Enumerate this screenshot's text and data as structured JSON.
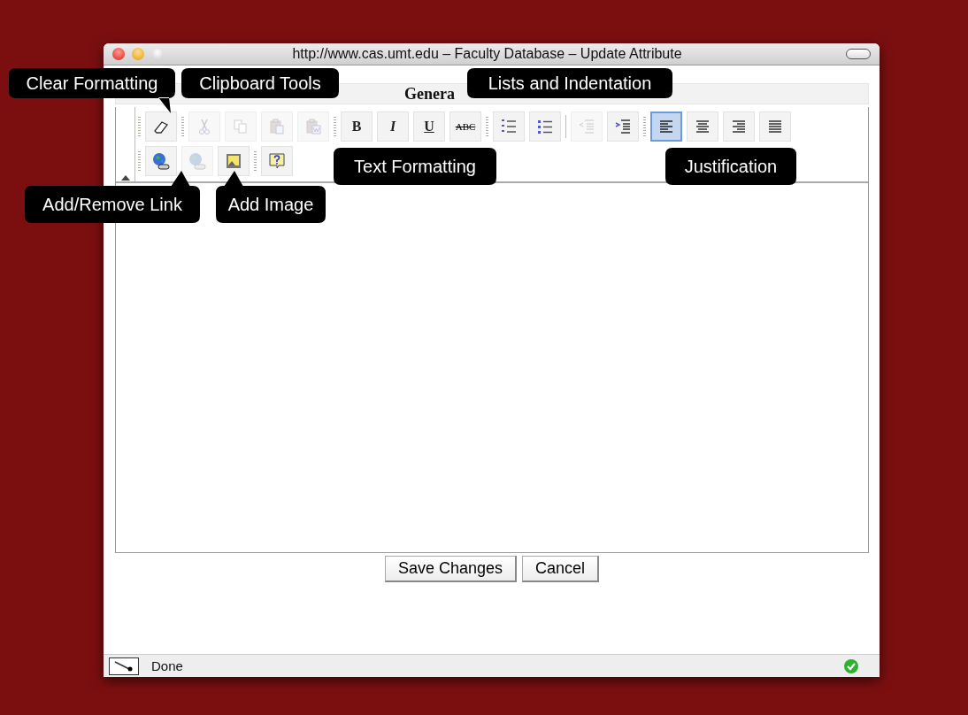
{
  "window": {
    "title": "http://www.cas.umt.edu – Faculty Database – Update Attribute"
  },
  "section_heading": "Genera",
  "toolbar_rows": [
    [
      {
        "kind": "grip"
      },
      {
        "kind": "button",
        "disabled": false,
        "selected": false
      },
      {
        "kind": "grip"
      },
      {
        "kind": "button",
        "disabled": true,
        "selected": false
      },
      {
        "kind": "button",
        "disabled": true,
        "selected": false
      },
      {
        "kind": "button",
        "disabled": true,
        "selected": false
      },
      {
        "kind": "button",
        "disabled": true,
        "selected": false
      },
      {
        "kind": "grip"
      },
      {
        "kind": "button",
        "label": "B",
        "disabled": false,
        "selected": false
      },
      {
        "kind": "button",
        "label": "I",
        "disabled": false,
        "selected": false
      },
      {
        "kind": "button",
        "label": "U",
        "disabled": false,
        "selected": false
      },
      {
        "kind": "button",
        "label": "ABC",
        "disabled": false,
        "selected": false
      },
      {
        "kind": "grip"
      },
      {
        "kind": "button",
        "disabled": false,
        "selected": false
      },
      {
        "kind": "button",
        "disabled": false,
        "selected": false
      },
      {
        "kind": "separator"
      },
      {
        "kind": "button",
        "disabled": true,
        "selected": false
      },
      {
        "kind": "button",
        "disabled": false,
        "selected": false
      },
      {
        "kind": "grip"
      },
      {
        "kind": "button",
        "disabled": false,
        "selected": true
      },
      {
        "kind": "button",
        "disabled": false,
        "selected": false
      },
      {
        "kind": "button",
        "disabled": false,
        "selected": false
      },
      {
        "kind": "button",
        "disabled": false,
        "selected": false
      }
    ],
    [
      {
        "kind": "grip"
      },
      {
        "kind": "button",
        "disabled": false,
        "selected": false
      },
      {
        "kind": "button",
        "disabled": true,
        "selected": false
      },
      {
        "kind": "button",
        "disabled": false,
        "selected": false
      },
      {
        "kind": "grip"
      },
      {
        "kind": "button",
        "disabled": false,
        "selected": false
      }
    ]
  ],
  "buttons": [
    "Save Changes",
    "Cancel"
  ],
  "status_bar": {
    "text": "Done"
  },
  "callouts": [
    {
      "text": "Clear Formatting"
    },
    {
      "text": "Clipboard Tools"
    },
    {
      "text": "Lists and Indentation"
    },
    {
      "text": "Text Formatting"
    },
    {
      "text": "Justification"
    },
    {
      "text": "Add/Remove Link"
    },
    {
      "text": "Add Image"
    }
  ]
}
